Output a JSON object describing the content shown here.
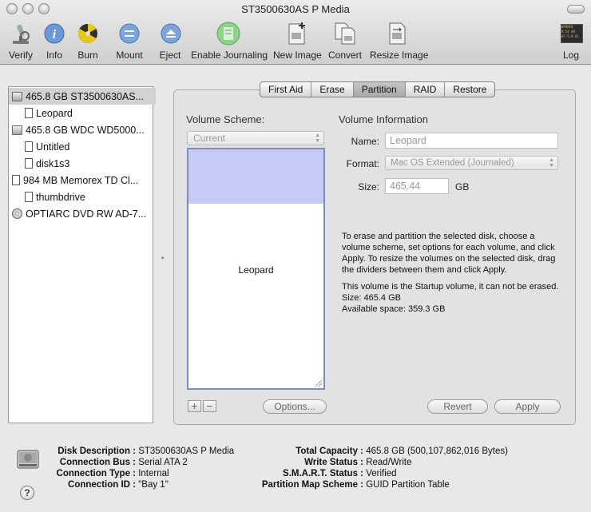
{
  "window": {
    "title": "ST3500630AS P Media"
  },
  "toolbar": {
    "verify": "Verify",
    "info": "Info",
    "burn": "Burn",
    "mount": "Mount",
    "eject": "Eject",
    "enable_journaling": "Enable Journaling",
    "new_image": "New Image",
    "convert": "Convert",
    "resize_image": "Resize Image",
    "log": "Log",
    "log_icon_text": "WARNIN\n9:54 AM\nAF-5:8:01"
  },
  "sidebar": {
    "items": [
      {
        "label": "465.8 GB ST3500630AS..."
      },
      {
        "label": "Leopard"
      },
      {
        "label": "465.8 GB WDC WD5000..."
      },
      {
        "label": "Untitled"
      },
      {
        "label": "disk1s3"
      },
      {
        "label": "984 MB Memorex TD Cl..."
      },
      {
        "label": "thumbdrive"
      },
      {
        "label": "OPTIARC DVD RW AD-7..."
      }
    ]
  },
  "tabs": [
    "First Aid",
    "Erase",
    "Partition",
    "RAID",
    "Restore"
  ],
  "active_tab": "Partition",
  "scheme": {
    "label": "Volume Scheme:",
    "selected": "Current",
    "volume_name": "Leopard",
    "add_label": "+",
    "remove_label": "−",
    "options_label": "Options...",
    "revert_label": "Revert",
    "apply_label": "Apply"
  },
  "volume_info": {
    "title": "Volume Information",
    "name_label": "Name:",
    "name_value": "Leopard",
    "format_label": "Format:",
    "format_value": "Mac OS Extended (Journaled)",
    "size_label": "Size:",
    "size_value": "465.44",
    "size_unit": "GB",
    "help_text": "To erase and partition the selected disk, choose a volume scheme, set options for each volume, and click Apply. To resize the volumes on the selected disk, drag the dividers between them and click Apply.",
    "status_line1": "This volume is the Startup volume, it can not be erased.",
    "status_line2": "Size: 465.4 GB",
    "status_line3": "Available space: 359.3 GB"
  },
  "disk_info": {
    "description_key": "Disk Description :",
    "description_val": "ST3500630AS P Media",
    "bus_key": "Connection Bus :",
    "bus_val": "Serial ATA 2",
    "type_key": "Connection Type :",
    "type_val": "Internal",
    "id_key": "Connection ID :",
    "id_val": "\"Bay 1\"",
    "capacity_key": "Total Capacity :",
    "capacity_val": "465.8 GB (500,107,862,016 Bytes)",
    "write_key": "Write Status :",
    "write_val": "Read/Write",
    "smart_key": "S.M.A.R.T. Status :",
    "smart_val": "Verified",
    "map_key": "Partition Map Scheme :",
    "map_val": "GUID Partition Table"
  },
  "help_button": "?"
}
